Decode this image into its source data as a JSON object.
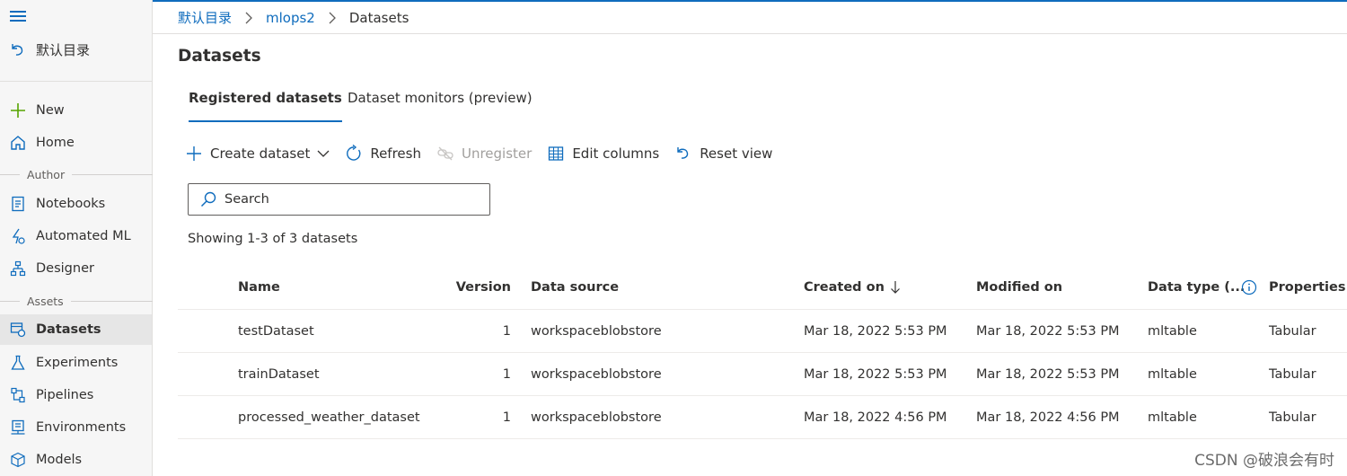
{
  "sidebar": {
    "back_label": "默认目录",
    "items_top": [
      {
        "label": "New",
        "icon": "plus-icon"
      },
      {
        "label": "Home",
        "icon": "home-icon"
      }
    ],
    "section_author": "Author",
    "items_author": [
      {
        "label": "Notebooks",
        "icon": "notebook-icon"
      },
      {
        "label": "Automated ML",
        "icon": "automated-ml-icon"
      },
      {
        "label": "Designer",
        "icon": "designer-icon"
      }
    ],
    "section_assets": "Assets",
    "items_assets": [
      {
        "label": "Datasets",
        "icon": "datasets-icon",
        "active": true
      },
      {
        "label": "Experiments",
        "icon": "flask-icon"
      },
      {
        "label": "Pipelines",
        "icon": "pipeline-icon"
      },
      {
        "label": "Environments",
        "icon": "environment-icon"
      },
      {
        "label": "Models",
        "icon": "cube-icon"
      }
    ]
  },
  "breadcrumb": [
    "默认目录",
    "mlops2",
    "Datasets"
  ],
  "page": {
    "title": "Datasets",
    "tabs": [
      {
        "label": "Registered datasets",
        "active": true
      },
      {
        "label": "Dataset monitors (preview)",
        "active": false
      }
    ]
  },
  "toolbar": {
    "create": "Create dataset",
    "refresh": "Refresh",
    "unregister": "Unregister",
    "edit_columns": "Edit columns",
    "reset_view": "Reset view"
  },
  "search": {
    "placeholder": "Search"
  },
  "showing": "Showing 1-3 of 3 datasets",
  "table": {
    "columns": {
      "name": "Name",
      "version": "Version",
      "source": "Data source",
      "created": "Created on",
      "modified": "Modified on",
      "type": "Data type (...",
      "properties": "Properties"
    },
    "rows": [
      {
        "name": "testDataset",
        "version": "1",
        "source": "workspaceblobstore",
        "created": "Mar 18, 2022 5:53 PM",
        "modified": "Mar 18, 2022 5:53 PM",
        "type": "mltable",
        "properties": "Tabular"
      },
      {
        "name": "trainDataset",
        "version": "1",
        "source": "workspaceblobstore",
        "created": "Mar 18, 2022 5:53 PM",
        "modified": "Mar 18, 2022 5:53 PM",
        "type": "mltable",
        "properties": "Tabular"
      },
      {
        "name": "processed_weather_dataset",
        "version": "1",
        "source": "workspaceblobstore",
        "created": "Mar 18, 2022 4:56 PM",
        "modified": "Mar 18, 2022 4:56 PM",
        "type": "mltable",
        "properties": "Tabular"
      }
    ]
  },
  "watermark": "CSDN @破浪会有时",
  "colors": {
    "accent": "#0f6cbd",
    "new_icon": "#57a300"
  }
}
